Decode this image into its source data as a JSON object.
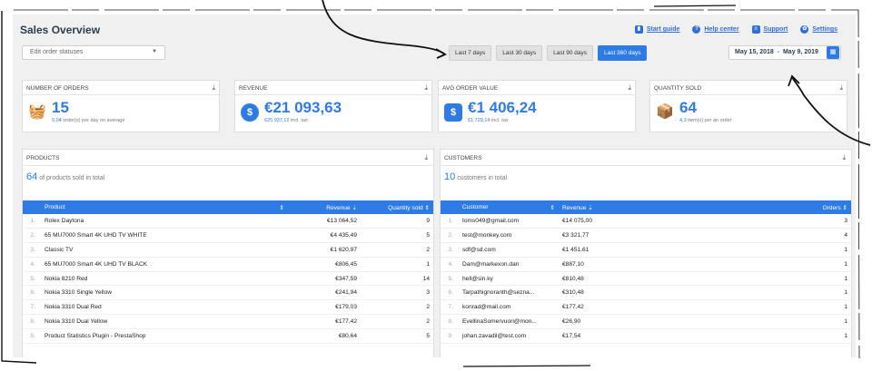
{
  "header": {
    "title": "Sales Overview",
    "links": [
      "Start guide",
      "Help center",
      "Support",
      "Settings"
    ]
  },
  "controls": {
    "status_select": "Edit order statuses",
    "ranges": [
      "Last 7 days",
      "Last 30 days",
      "Last 90 days",
      "Last 360 days"
    ],
    "active_range": "Last 360 days",
    "date_from": "May 15, 2018",
    "date_sep": "-",
    "date_to": "May 9, 2019"
  },
  "kpis": [
    {
      "title": "NUMBER OF ORDERS",
      "value": "15",
      "sub_value": "0,04",
      "sub_text": "order(s) per day on average",
      "icon": "basket-icon"
    },
    {
      "title": "REVENUE",
      "value": "€21 093,63",
      "sub_value": "€25 937,12",
      "sub_text": "incl. tax",
      "icon": "dollar-icon"
    },
    {
      "title": "AVG ORDER VALUE",
      "value": "€1 406,24",
      "sub_value": "€1 729,14",
      "sub_text": "incl. tax",
      "icon": "shopping-bag-icon"
    },
    {
      "title": "QUANTITY SOLD",
      "value": "64",
      "sub_value": "4,3",
      "sub_text": "item(s) per an order",
      "icon": "boxes-icon"
    }
  ],
  "products": {
    "title": "PRODUCTS",
    "count": "64",
    "count_text": "of products sold in total",
    "columns": [
      "Product",
      "Revenue",
      "Quantity sold"
    ],
    "rows": [
      [
        "1.",
        "Rolex Daytona",
        "€13 064,52",
        "9"
      ],
      [
        "2.",
        "65 MU7000 Smart 4K UHD TV WHITE",
        "€4 435,49",
        "5"
      ],
      [
        "3.",
        "Classic TV",
        "€1 620,97",
        "2"
      ],
      [
        "4.",
        "65 MU7000 Smart 4K UHD TV BLACK",
        "€806,45",
        "1"
      ],
      [
        "5.",
        "Nokia 8210 Red",
        "€347,59",
        "14"
      ],
      [
        "6.",
        "Nokia 3310 Single Yellow",
        "€241,94",
        "3"
      ],
      [
        "7.",
        "Nokia 3310 Dual Red",
        "€179,03",
        "2"
      ],
      [
        "8.",
        "Nokia 3310 Dual Yellow",
        "€177,42",
        "2"
      ],
      [
        "9.",
        "Product Statistics Plugin - PrestaShop",
        "€80,64",
        "5"
      ]
    ]
  },
  "customers": {
    "title": "CUSTOMERS",
    "count": "10",
    "count_text": "customers in total",
    "columns": [
      "Customer",
      "Revenue",
      "Orders"
    ],
    "rows": [
      [
        "1.",
        "toms049@gmail.com",
        "€14 075,00",
        "3"
      ],
      [
        "2.",
        "test@monkey.com",
        "€3 321,77",
        "4"
      ],
      [
        "3.",
        "sdf@sd.com",
        "€1 451,61",
        "1"
      ],
      [
        "4.",
        "Dam@markexon.dan",
        "€887,10",
        "1"
      ],
      [
        "5.",
        "hell@sin.ky",
        "€810,48",
        "1"
      ],
      [
        "6.",
        "Tarpathignoranth@sezna...",
        "€310,48",
        "1"
      ],
      [
        "7.",
        "konrad@mail.com",
        "€177,42",
        "1"
      ],
      [
        "8.",
        "EvellinaSomervuori@mon...",
        "€26,90",
        "1"
      ],
      [
        "9.",
        "johan.zavadil@test.com",
        "€17,54",
        "1"
      ]
    ]
  },
  "accent_color": "#2f7be5"
}
